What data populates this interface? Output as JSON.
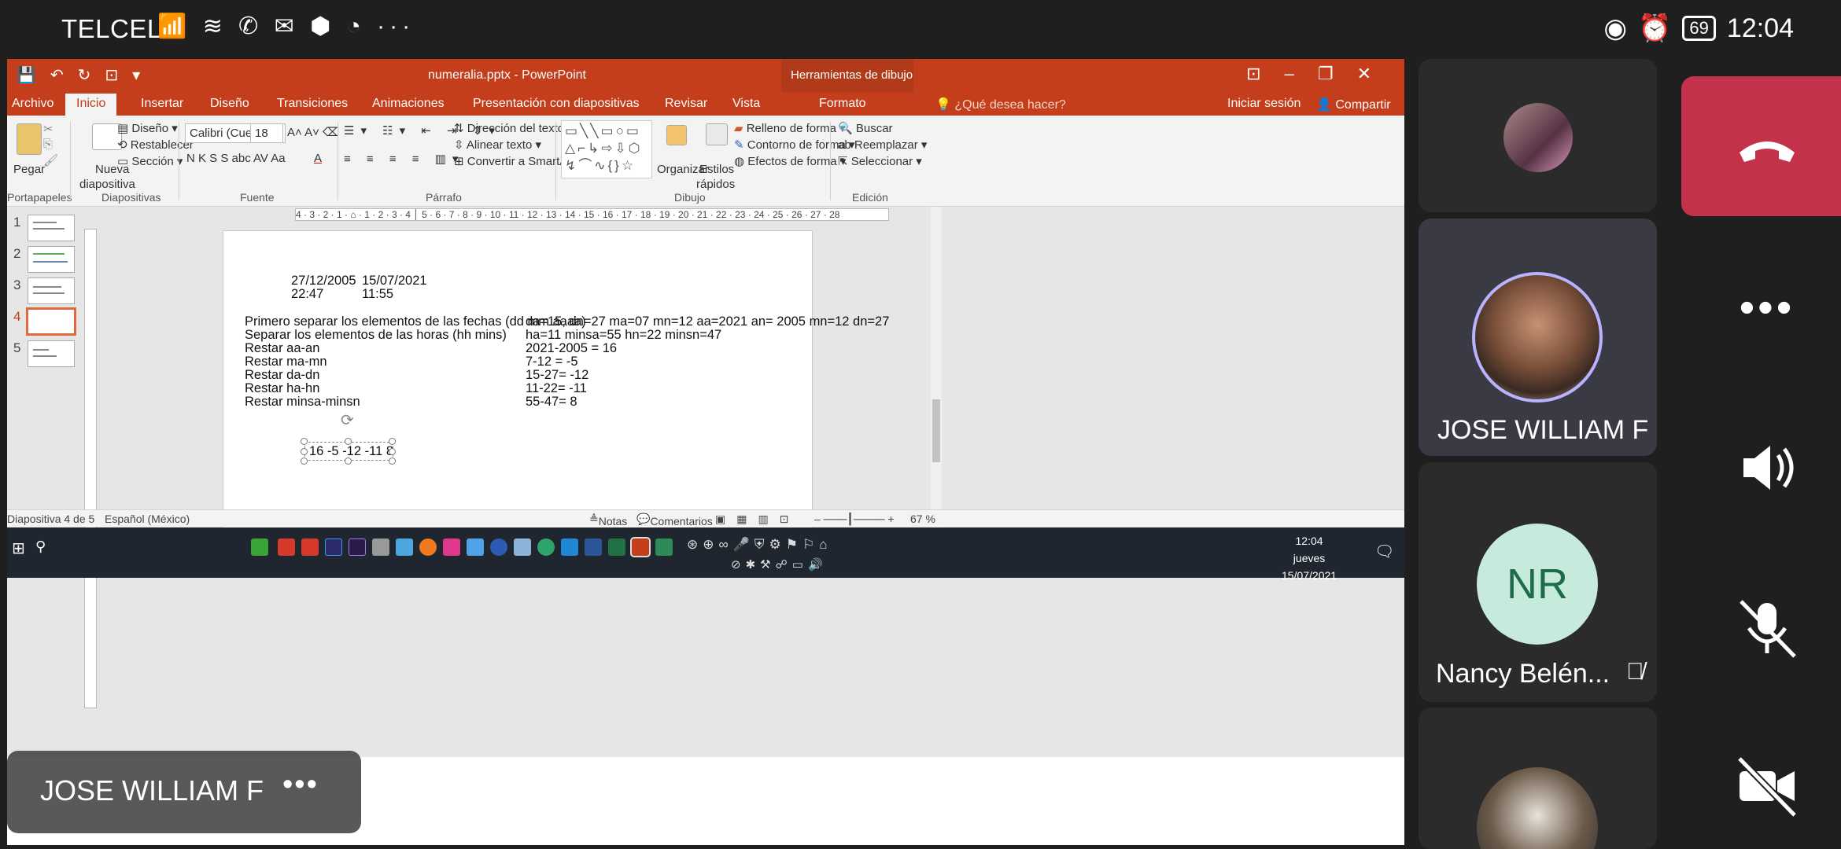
{
  "status_bar": {
    "carrier": "TELCEL",
    "icons_text": "📶 ≋ ✆ ✉ ⬢ ◔ ···",
    "icons": [
      "signal-icon",
      "wifi-icon",
      "missed-call-icon",
      "phone-icon",
      "mail-icon",
      "teams-icon",
      "messenger-icon",
      "more-icon"
    ],
    "right_icons": [
      "eye-icon",
      "alarm-icon"
    ],
    "battery": "69",
    "time": "12:04"
  },
  "powerpoint": {
    "title": "numeralia.pptx - PowerPoint",
    "contextual_header": "Herramientas de dibujo",
    "tabs": [
      "Archivo",
      "Inicio",
      "Insertar",
      "Diseño",
      "Transiciones",
      "Animaciones",
      "Presentación con diapositivas",
      "Revisar",
      "Vista",
      "Formato"
    ],
    "active_tab": "Inicio",
    "help_placeholder": "¿Qué desea hacer?",
    "login": "Iniciar sesión",
    "share": "Compartir",
    "ribbon": {
      "paste": "Pegar",
      "new_slide_l1": "Nueva",
      "new_slide_l2": "diapositiva",
      "layout": "Diseño",
      "reset": "Restablecer",
      "section": "Sección",
      "font_name": "Calibri (Cuerpo",
      "font_size": "18",
      "fmt_buttons": "N   K   S   S   abc   AV   Aa",
      "text_direction": "Dirección del texto",
      "align_text": "Alinear texto",
      "smartart": "Convertir a SmartArt",
      "organize": "Organizar",
      "quick_styles_l1": "Estilos",
      "quick_styles_l2": "rápidos",
      "shape_fill": "Relleno de forma",
      "shape_outline": "Contorno de forma",
      "shape_effects": "Efectos de forma",
      "find": "Buscar",
      "replace": "Reemplazar",
      "select": "Seleccionar",
      "groups": [
        "Portapapeles",
        "Diapositivas",
        "Fuente",
        "Párrafo",
        "Dibujo",
        "Edición"
      ]
    },
    "thumbnails": [
      "1",
      "2",
      "3",
      "4",
      "5"
    ],
    "selected_thumbnail": "4",
    "ruler_text": "4 · 3 · 2 · 1 · ⌂ · 1 · 2 · 3 · 4 │ 5 · 6 · 7 · 8 · 9 · 10 · 11 · 12 · 13 · 14 · 15 · 16 · 17 · 18 · 19 · 20 · 21 · 22 · 23 · 24 · 25 · 26 · 27 · 28",
    "slide": {
      "date1": "27/12/2005",
      "date2": "15/07/2021",
      "time1": "22:47",
      "time2": "11:55",
      "left_lines": [
        "Primero separar los elementos de las fechas  (dd  mm  aaaa)",
        "Separar los elementos de las horas (hh mins)",
        "Restar aa-an",
        "Restar ma-mn",
        "Restar da-dn",
        "Restar ha-hn",
        "Restar minsa-minsn"
      ],
      "right_lines": [
        "da=15, dn=27 ma=07  mn=12 aa=2021 an= 2005 mn=12 dn=27",
        "ha=11 minsa=55  hn=22  minsn=47",
        "2021-2005 = 16",
        "7-12 = -5",
        "15-27= -12",
        "11-22= -11",
        "55-47= 8"
      ],
      "result_box": "16   -5  -12  -11  8"
    },
    "statusbar": {
      "slide_counter": "Diapositiva 4 de 5",
      "language": "Español (México)",
      "notes": "Notas",
      "comments": "Comentarios",
      "zoom": "67 %"
    },
    "taskbar": {
      "clock_time": "12:04",
      "clock_day": "jueves",
      "clock_date": "15/07/2021"
    }
  },
  "presenter_overlay": {
    "name": "JOSE WILLIAM F",
    "more": "•••"
  },
  "participants": [
    {
      "name": "",
      "initials": ""
    },
    {
      "name": "JOSE WILLIAM F",
      "initials": ""
    },
    {
      "name": "Nancy Belén...",
      "initials": "NR",
      "avatar_color": "#c6eadb",
      "initials_color": "#1e6b4a"
    },
    {
      "name": "",
      "initials": ""
    }
  ],
  "controls": {
    "end_call_color": "#c4314b",
    "more": "•••"
  }
}
